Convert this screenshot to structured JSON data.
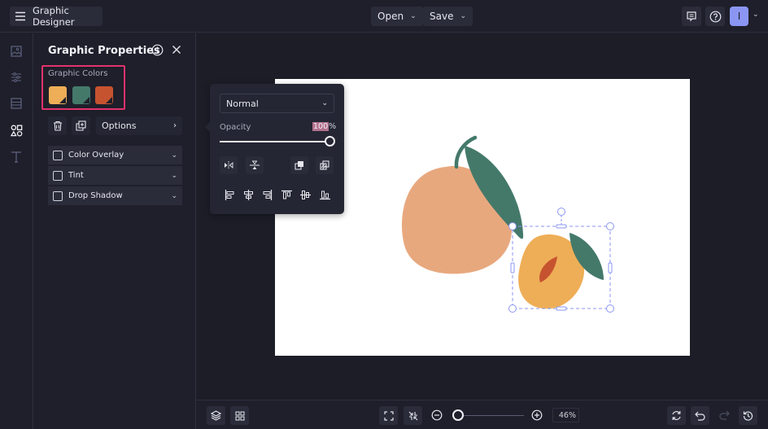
{
  "topbar": {
    "app_title": "Graphic Designer",
    "open_label": "Open",
    "save_label": "Save",
    "avatar_initial": "I"
  },
  "rail": {
    "items": [
      {
        "name": "image",
        "active": false
      },
      {
        "name": "adjustments",
        "active": false
      },
      {
        "name": "layout",
        "active": false
      },
      {
        "name": "graphics",
        "active": true
      },
      {
        "name": "text",
        "active": false
      }
    ]
  },
  "panel": {
    "title": "Graphic Properties",
    "colors_label": "Graphic Colors",
    "swatches": [
      "#eeae57",
      "#44796a",
      "#c6532f"
    ],
    "options_label": "Options",
    "accordions": [
      {
        "label": "Color Overlay",
        "checked": false
      },
      {
        "label": "Tint",
        "checked": false
      },
      {
        "label": "Drop Shadow",
        "checked": false
      }
    ]
  },
  "popover": {
    "blend_mode": "Normal",
    "opacity_label": "Opacity",
    "opacity_value": "100",
    "opacity_unit": "%"
  },
  "bottombar": {
    "zoom_value": "46%"
  },
  "colors": {
    "accent_highlight": "#e3326d",
    "selection": "#8b96f3",
    "peach": "#e8a87e",
    "apricot": "#eeae57",
    "leaf": "#44796a",
    "pit": "#c6532f"
  }
}
